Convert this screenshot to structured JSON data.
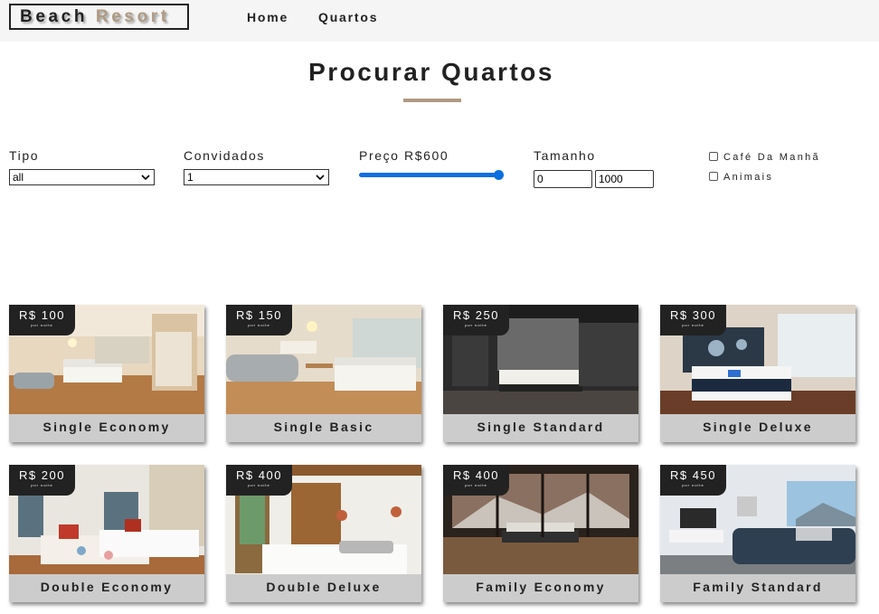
{
  "navbar": {
    "logo_part1": "Beach",
    "logo_part2": "Resort",
    "links": [
      "Home",
      "Quartos"
    ]
  },
  "page": {
    "title": "Procurar Quartos",
    "accent_color": "#b09a82"
  },
  "filters": {
    "type_label": "Tipo",
    "type_value": "all",
    "guests_label": "Convidados",
    "guests_value": "1",
    "price_label": "Preço R$600",
    "price_fraction": 1.0,
    "size_label": "Tamanho",
    "size_min": "0",
    "size_max": "1000",
    "breakfast_label": "Café Da Manhã",
    "pets_label": "Animais",
    "breakfast_checked": false,
    "pets_checked": false,
    "slider_color": "#0b6fe0"
  },
  "rooms": [
    {
      "name": "Single Economy",
      "price": "R$ 100",
      "per": "por noite"
    },
    {
      "name": "Single Basic",
      "price": "R$ 150",
      "per": "por noite"
    },
    {
      "name": "Single Standard",
      "price": "R$ 250",
      "per": "por noite"
    },
    {
      "name": "Single Deluxe",
      "price": "R$ 300",
      "per": "por noite"
    },
    {
      "name": "Double Economy",
      "price": "R$ 200",
      "per": "por noite"
    },
    {
      "name": "Double Deluxe",
      "price": "R$ 400",
      "per": "por noite"
    },
    {
      "name": "Family Economy",
      "price": "R$ 400",
      "per": "por noite"
    },
    {
      "name": "Family Standard",
      "price": "R$ 450",
      "per": "por noite"
    }
  ]
}
